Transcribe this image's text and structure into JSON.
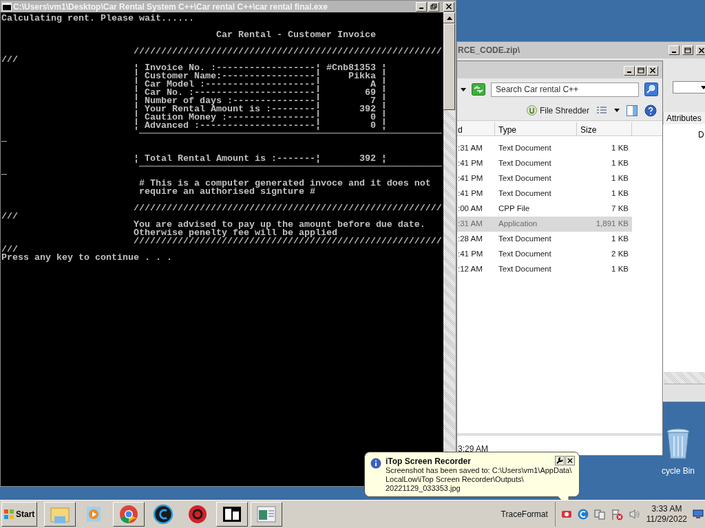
{
  "console_window": {
    "title": "C:\\Users\\vm1\\Desktop\\Car Rental System C++\\Car rental C++\\car rental final.exe",
    "output": "Calculating rent. Please wait......\n\n                                       Car Rental - Customer Invoice\n\n                        ////////////////////////////////////////////////////////\n///\n                        ¦ Invoice No. :------------------¦ #Cnb81353 ¦\n                        ¦ Customer Name:-----------------¦     Pikka ¦\n                        ¦ Car Model :--------------------¦         A ¦\n                        ¦ Car No. :----------------------¦        69 ¦\n                        ¦ Number of days :---------------¦         7 ¦\n                        ¦ Your Rental Amount is :--------¦       392 ¦\n                        ¦ Caution Money :----------------¦         0 ¦\n                        ¦ Advanced :---------------------¦         0 ¦\n                         ───────────────────────────────────────────────────────\n─\n\n                        ¦ Total Rental Amount is :-------¦       392 ¦\n                         ───────────────────────────────────────────────────────\n─\n                         # This is a computer generated invoce and it does not\n                         require an authorised signture #\n\n                        ////////////////////////////////////////////////////////\n///\n                        You are advised to pay up the amount before due date.\n                        Otherwise penelty fee will be applied\n                        ////////////////////////////////////////////////////////\n///\nPress any key to continue . . ."
  },
  "back_explorer": {
    "title": "RCE_CODE.zip\\",
    "column": "Attributes",
    "cell": "D"
  },
  "explorer": {
    "search_placeholder": "Search Car rental C++",
    "toolbar_button": "File Shredder",
    "columns": [
      "d",
      "Type",
      "Size"
    ],
    "rows": [
      {
        "modified": ":31 AM",
        "type": "Text Document",
        "size": "1 KB",
        "selected": false
      },
      {
        "modified": ":41 PM",
        "type": "Text Document",
        "size": "1 KB",
        "selected": false
      },
      {
        "modified": ":41 PM",
        "type": "Text Document",
        "size": "1 KB",
        "selected": false
      },
      {
        "modified": ":41 PM",
        "type": "Text Document",
        "size": "1 KB",
        "selected": false
      },
      {
        "modified": ":00 AM",
        "type": "CPP File",
        "size": "7 KB",
        "selected": false
      },
      {
        "modified": ":31 AM",
        "type": "Application",
        "size": "1,891 KB",
        "selected": true
      },
      {
        "modified": ":28 AM",
        "type": "Text Document",
        "size": "1 KB",
        "selected": false
      },
      {
        "modified": ":41 PM",
        "type": "Text Document",
        "size": "2 KB",
        "selected": false
      },
      {
        "modified": ":12 AM",
        "type": "Text Document",
        "size": "1 KB",
        "selected": false
      }
    ],
    "details_text": "3:29 AM"
  },
  "desktop": {
    "recycle_bin_label": "cycle Bin"
  },
  "notification": {
    "title": "iTop Screen Recorder",
    "message": "Screenshot has been saved to: C:\\Users\\vm1\\AppData\\\nLocalLow\\iTop Screen Recorder\\Outputs\\\n20221129_033353.jpg"
  },
  "taskbar": {
    "start": "Start",
    "tray_label": "TraceFormat",
    "time": "3:33 AM",
    "date": "11/29/2022"
  }
}
